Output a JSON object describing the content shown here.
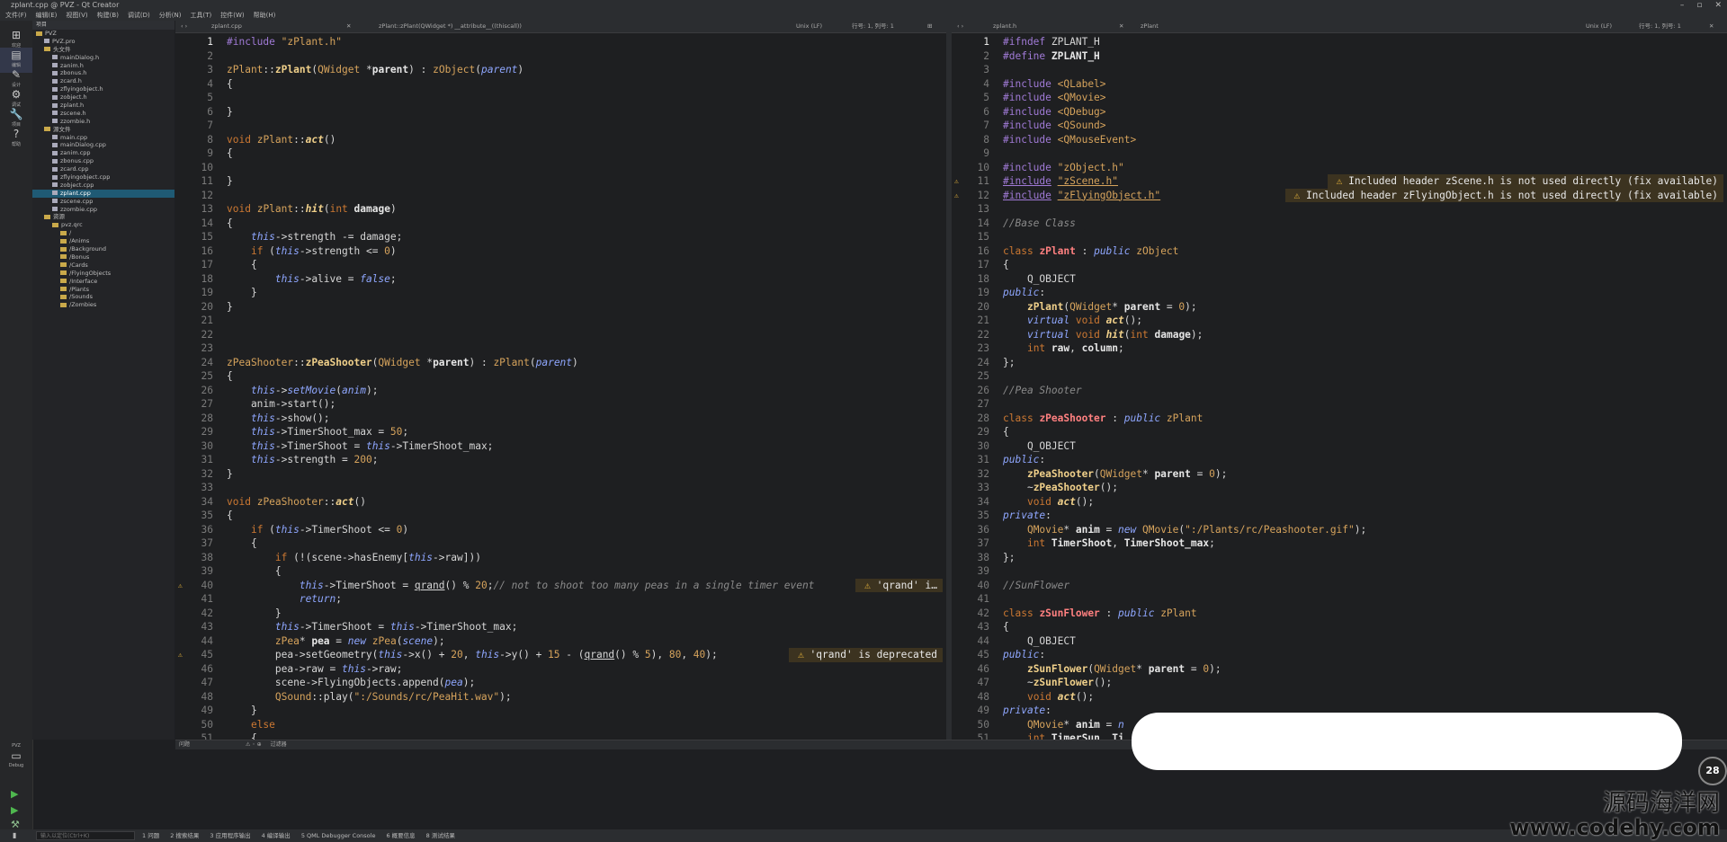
{
  "window": {
    "title": "zplant.cpp @ PVZ - Qt Creator"
  },
  "menu": [
    "文件(F)",
    "编辑(E)",
    "视图(V)",
    "构建(B)",
    "调试(D)",
    "分析(N)",
    "工具(T)",
    "控件(W)",
    "帮助(H)"
  ],
  "modes": [
    "欢迎",
    "编辑",
    "设计",
    "调试",
    "项目",
    "帮助"
  ],
  "kit": {
    "name": "PVZ",
    "mode": "Debug"
  },
  "sidebar": {
    "header": "项目",
    "items": [
      {
        "label": "PVZ",
        "type": "folder",
        "indent": 0
      },
      {
        "label": "PVZ.pro",
        "type": "file",
        "indent": 1
      },
      {
        "label": "头文件",
        "type": "folder",
        "indent": 1
      },
      {
        "label": "mainDialog.h",
        "type": "file",
        "indent": 2
      },
      {
        "label": "zanim.h",
        "type": "file",
        "indent": 2
      },
      {
        "label": "zbonus.h",
        "type": "file",
        "indent": 2
      },
      {
        "label": "zcard.h",
        "type": "file",
        "indent": 2
      },
      {
        "label": "zflyingobject.h",
        "type": "file",
        "indent": 2
      },
      {
        "label": "zobject.h",
        "type": "file",
        "indent": 2
      },
      {
        "label": "zplant.h",
        "type": "file",
        "indent": 2
      },
      {
        "label": "zscene.h",
        "type": "file",
        "indent": 2
      },
      {
        "label": "zzombie.h",
        "type": "file",
        "indent": 2
      },
      {
        "label": "源文件",
        "type": "folder",
        "indent": 1
      },
      {
        "label": "main.cpp",
        "type": "file",
        "indent": 2
      },
      {
        "label": "mainDialog.cpp",
        "type": "file",
        "indent": 2
      },
      {
        "label": "zanim.cpp",
        "type": "file",
        "indent": 2
      },
      {
        "label": "zbonus.cpp",
        "type": "file",
        "indent": 2
      },
      {
        "label": "zcard.cpp",
        "type": "file",
        "indent": 2
      },
      {
        "label": "zflyingobject.cpp",
        "type": "file",
        "indent": 2
      },
      {
        "label": "zobject.cpp",
        "type": "file",
        "indent": 2
      },
      {
        "label": "zplant.cpp",
        "type": "file",
        "indent": 2,
        "selected": true
      },
      {
        "label": "zscene.cpp",
        "type": "file",
        "indent": 2
      },
      {
        "label": "zzombie.cpp",
        "type": "file",
        "indent": 2
      },
      {
        "label": "资源",
        "type": "folder",
        "indent": 1
      },
      {
        "label": "pvz.qrc",
        "type": "folder",
        "indent": 2
      },
      {
        "label": "/",
        "type": "folder",
        "indent": 3
      },
      {
        "label": "/Anims",
        "type": "folder",
        "indent": 3
      },
      {
        "label": "/Background",
        "type": "folder",
        "indent": 3
      },
      {
        "label": "/Bonus",
        "type": "folder",
        "indent": 3
      },
      {
        "label": "/Cards",
        "type": "folder",
        "indent": 3
      },
      {
        "label": "/FlyingObjects",
        "type": "folder",
        "indent": 3
      },
      {
        "label": "/Interface",
        "type": "folder",
        "indent": 3
      },
      {
        "label": "/Plants",
        "type": "folder",
        "indent": 3
      },
      {
        "label": "/Sounds",
        "type": "folder",
        "indent": 3
      },
      {
        "label": "/Zombies",
        "type": "folder",
        "indent": 3
      }
    ]
  },
  "left_editor": {
    "file": "zplant.cpp",
    "symbol": "zPlant::zPlant(QWidget *) __attribute__((thiscall))",
    "encoding": "Unix (LF)",
    "position": "行号: 1, 列号: 1",
    "current_line": 1,
    "warning_lines": [
      40,
      45
    ],
    "lines": [
      "<span class='pp'>#include</span> <span class='str'>\"zPlant.h\"</span>",
      "",
      "<span class='ty'>zPlant</span>::<span class='fn'>zPlant</span>(<span class='ty'>QWidget</span> *<span class='bold'>parent</span>) : <span class='ty'>zObject</span>(<span class='it'>parent</span>)",
      "{",
      "",
      "}",
      "",
      "<span class='k'>void</span> <span class='ty'>zPlant</span>::<span class='fn'><i>act</i></span>()",
      "{",
      "",
      "}",
      "",
      "<span class='k'>void</span> <span class='ty'>zPlant</span>::<span class='fn'><i>hit</i></span>(<span class='k'>int</span> <span class='bold'>damage</span>)",
      "{",
      "    <span class='it'>this</span>->strength -= damage;",
      "    <span class='k'>if</span> (<span class='it'>this</span>->strength <= <span class='num'>0</span>)",
      "    {",
      "        <span class='it'>this</span>->alive = <span class='it'>false</span>;",
      "    }",
      "}",
      "",
      "",
      "",
      "<span class='ty'>zPeaShooter</span>::<span class='fn'>zPeaShooter</span>(<span class='ty'>QWidget</span> *<span class='bold'>parent</span>) : <span class='ty'>zPlant</span>(<span class='it'>parent</span>)",
      "{",
      "    <span class='it'>this</span>-><span class='it'>setMovie</span>(<span class='it'>anim</span>);",
      "    anim->start();",
      "    <span class='it'>this</span>->show();",
      "    <span class='it'>this</span>->TimerShoot_max = <span class='num'>50</span>;",
      "    <span class='it'>this</span>->TimerShoot = <span class='it'>this</span>->TimerShoot_max;",
      "    <span class='it'>this</span>->strength = <span class='num'>200</span>;",
      "}",
      "",
      "<span class='k'>void</span> <span class='ty'>zPeaShooter</span>::<span class='fn'><i>act</i></span>()",
      "{",
      "    <span class='k'>if</span> (<span class='it'>this</span>->TimerShoot <= <span class='num'>0</span>)",
      "    {",
      "        <span class='k'>if</span> (!(scene->hasEnemy[<span class='it'>this</span>->raw]))",
      "        {",
      "            <span class='it'>this</span>->TimerShoot = <u>qrand</u>() % <span class='num'>20</span>;<span class='cm'>// not to shoot too many peas in a single timer event</span>",
      "            <span class='it'>return</span>;",
      "        }",
      "        <span class='it'>this</span>->TimerShoot = <span class='it'>this</span>->TimerShoot_max;",
      "        <span class='ty'>zPea</span>* <span class='bold'>pea</span> = <span class='it'>new</span> <span class='ty'>zPea</span>(<span class='it'>scene</span>);",
      "        pea->setGeometry(<span class='it'>this</span>->x() + <span class='num'>20</span>, <span class='it'>this</span>->y() + <span class='num'>15</span> - (<u>qrand</u>() % <span class='num'>5</span>), <span class='num'>80</span>, <span class='num'>40</span>);",
      "        pea->raw = <span class='it'>this</span>->raw;",
      "        scene->FlyingObjects.append(<span class='it'>pea</span>);",
      "        <span class='ty'>QSound</span>::play(<span class='str'>\":/Sounds/rc/PeaHit.wav\"</span>);",
      "    }",
      "    <span class='k'>else</span>",
      "    {"
    ],
    "warnings": [
      {
        "line": 40,
        "text": "'qrand' i…"
      },
      {
        "line": 45,
        "text": "'qrand' is deprecated"
      }
    ]
  },
  "right_editor": {
    "file": "zplant.h",
    "symbol": "zPlant",
    "encoding": "Unix (LF)",
    "position": "行号: 1, 列号: 1",
    "current_line": 1,
    "warning_lines": [
      11,
      12
    ],
    "lines": [
      "<span class='pp'>#ifndef</span> ZPLANT_H",
      "<span class='pp'>#define</span> <span class='bold'>ZPLANT_H</span>",
      "",
      "<span class='pp'>#include</span> <span class='str'>&lt;QLabel&gt;</span>",
      "<span class='pp'>#include</span> <span class='str'>&lt;QMovie&gt;</span>",
      "<span class='pp'>#include</span> <span class='str'>&lt;QDebug&gt;</span>",
      "<span class='pp'>#include</span> <span class='str'>&lt;QSound&gt;</span>",
      "<span class='pp'>#include</span> <span class='str'>&lt;QMouseEvent&gt;</span>",
      "",
      "<span class='pp'>#include</span> <span class='str'>\"zObject.h\"</span>",
      "<span class='pp'><u>#include</u></span> <span class='str'><u>\"zScene.h\"</u></span>",
      "<span class='pp'><u>#include</u></span> <span class='str'><u>\"zFlyingObject.h\"</u></span>",
      "",
      "<span class='cm'>//Base Class</span>",
      "",
      "<span class='k'>class</span> <span class='cls'>zPlant</span> : <span class='it'>public</span> <span class='ty'>zObject</span>",
      "{",
      "    Q_OBJECT",
      "<span class='it'>public</span>:",
      "    <span class='fn'>zPlant</span>(<span class='ty'>QWidget</span>* <span class='bold'>parent</span> = <span class='num'>0</span>);",
      "    <span class='it'>virtual</span> <span class='k'>void</span> <span class='fn'><i>act</i></span>();",
      "    <span class='it'>virtual</span> <span class='k'>void</span> <span class='fn'><i>hit</i></span>(<span class='k'>int</span> <span class='bold'>damage</span>);",
      "    <span class='k'>int</span> <span class='bold'>raw</span>, <span class='bold'>column</span>;",
      "};",
      "",
      "<span class='cm'>//Pea Shooter</span>",
      "",
      "<span class='k'>class</span> <span class='cls'>zPeaShooter</span> : <span class='it'>public</span> <span class='ty'>zPlant</span>",
      "{",
      "    Q_OBJECT",
      "<span class='it'>public</span>:",
      "    <span class='fn'>zPeaShooter</span>(<span class='ty'>QWidget</span>* <span class='bold'>parent</span> = <span class='num'>0</span>);",
      "    ~<span class='fn'>zPeaShooter</span>();",
      "    <span class='k'>void</span> <span class='fn'><i>act</i></span>();",
      "<span class='it'>private</span>:",
      "    <span class='ty'>QMovie</span>* <span class='bold'>anim</span> = <span class='it'>new</span> <span class='ty'>QMovie</span>(<span class='str'>\":/Plants/rc/Peashooter.gif\"</span>);",
      "    <span class='k'>int</span> <span class='bold'>TimerShoot</span>, <span class='bold'>TimerShoot_max</span>;",
      "};",
      "",
      "<span class='cm'>//SunFlower</span>",
      "",
      "<span class='k'>class</span> <span class='cls'>zSunFlower</span> : <span class='it'>public</span> <span class='ty'>zPlant</span>",
      "{",
      "    Q_OBJECT",
      "<span class='it'>public</span>:",
      "    <span class='fn'>zSunFlower</span>(<span class='ty'>QWidget</span>* <span class='bold'>parent</span> = <span class='num'>0</span>);",
      "    ~<span class='fn'>zSunFlower</span>();",
      "    <span class='k'>void</span> <span class='fn'><i>act</i></span>();",
      "<span class='it'>private</span>:",
      "    <span class='ty'>QMovie</span>* <span class='bold'>anim</span> = <span class='it'>n</span>",
      "    <span class='k'>int</span> <span class='bold'>TimerSun</span>, <span class='bold'>Ti</span>"
    ],
    "warnings": [
      {
        "line": 11,
        "text": "Included header zScene.h is not used directly (fix available)"
      },
      {
        "line": 12,
        "text": "Included header zFlyingObject.h is not used directly (fix available)"
      }
    ]
  },
  "bottom_panel": {
    "title": "问题",
    "filter": "过滤器"
  },
  "statusbar": {
    "search_placeholder": "输入以定位(Ctrl+K)",
    "tabs": [
      "1 问题",
      "2 搜索结果",
      "3 应用程序输出",
      "4 编译输出",
      "5 QML Debugger Console",
      "6 概要信息",
      "8 测试结果"
    ]
  },
  "badge": {
    "value": "28"
  },
  "watermark": {
    "title": "源码海洋网",
    "url": "www.codehy.com"
  },
  "colors": {
    "accent": "#1f5a74",
    "warning": "#e6b43c",
    "background": "#1e1f21"
  }
}
